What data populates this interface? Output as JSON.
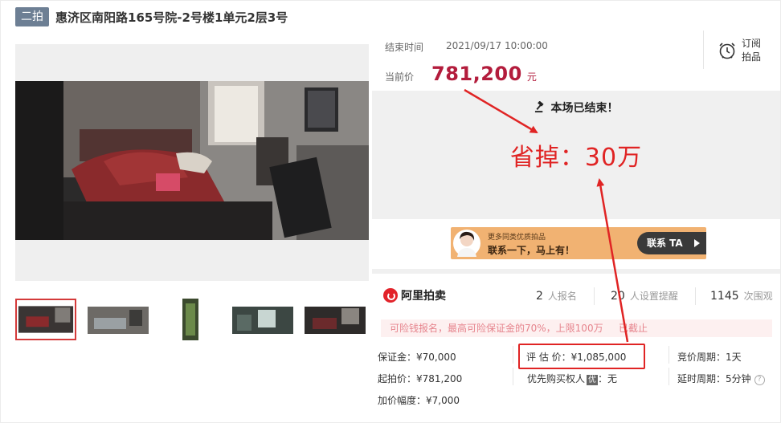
{
  "title": {
    "round_badge": "二拍",
    "text": "惠济区南阳路165号院-2号楼1单元2层3号"
  },
  "auction": {
    "end_label": "结束时间",
    "end_time": "2021/09/17 10:00:00",
    "price_label": "当前价",
    "price": "781,200",
    "currency_unit": "元",
    "subscribe_line1": "订阅",
    "subscribe_line2": "拍品"
  },
  "status": {
    "ended_text": "本场已结束！",
    "annotation": "省掉：30万"
  },
  "banner": {
    "small_text": "更多同类优质拍品",
    "big_text": "联系一下，马上有！",
    "button": "联系 TA"
  },
  "stats": {
    "logo_name": "阿里拍卖",
    "signup_count": "2",
    "signup_label": "人报名",
    "reminder_count": "20",
    "reminder_label": "人设置提醒",
    "views_count": "1145",
    "views_label": "次围观"
  },
  "notice": {
    "text": "可险钱报名，最高可险保证金的70%，上限100万",
    "status": "已截止"
  },
  "details": {
    "deposit": "保证金：¥70,000",
    "start_price": "起拍价：¥781,200",
    "increment": "加价幅度：¥7,000",
    "appraisal": "评 估 价：¥1,085,000",
    "priority_label": "优先购买权人",
    "priority_badge": "优",
    "priority_value": "：无",
    "bid_cycle": "竞价周期：1天",
    "delay_cycle": "延时周期：5分钟"
  },
  "colors": {
    "price": "#b31c3c",
    "annotation_red": "#e02424",
    "badge_bg": "#6d7f94"
  },
  "icons": [
    "alarm-clock-icon",
    "gavel-icon",
    "question-circle-icon",
    "arrow-right-icon",
    "aliauction-logo-icon"
  ]
}
